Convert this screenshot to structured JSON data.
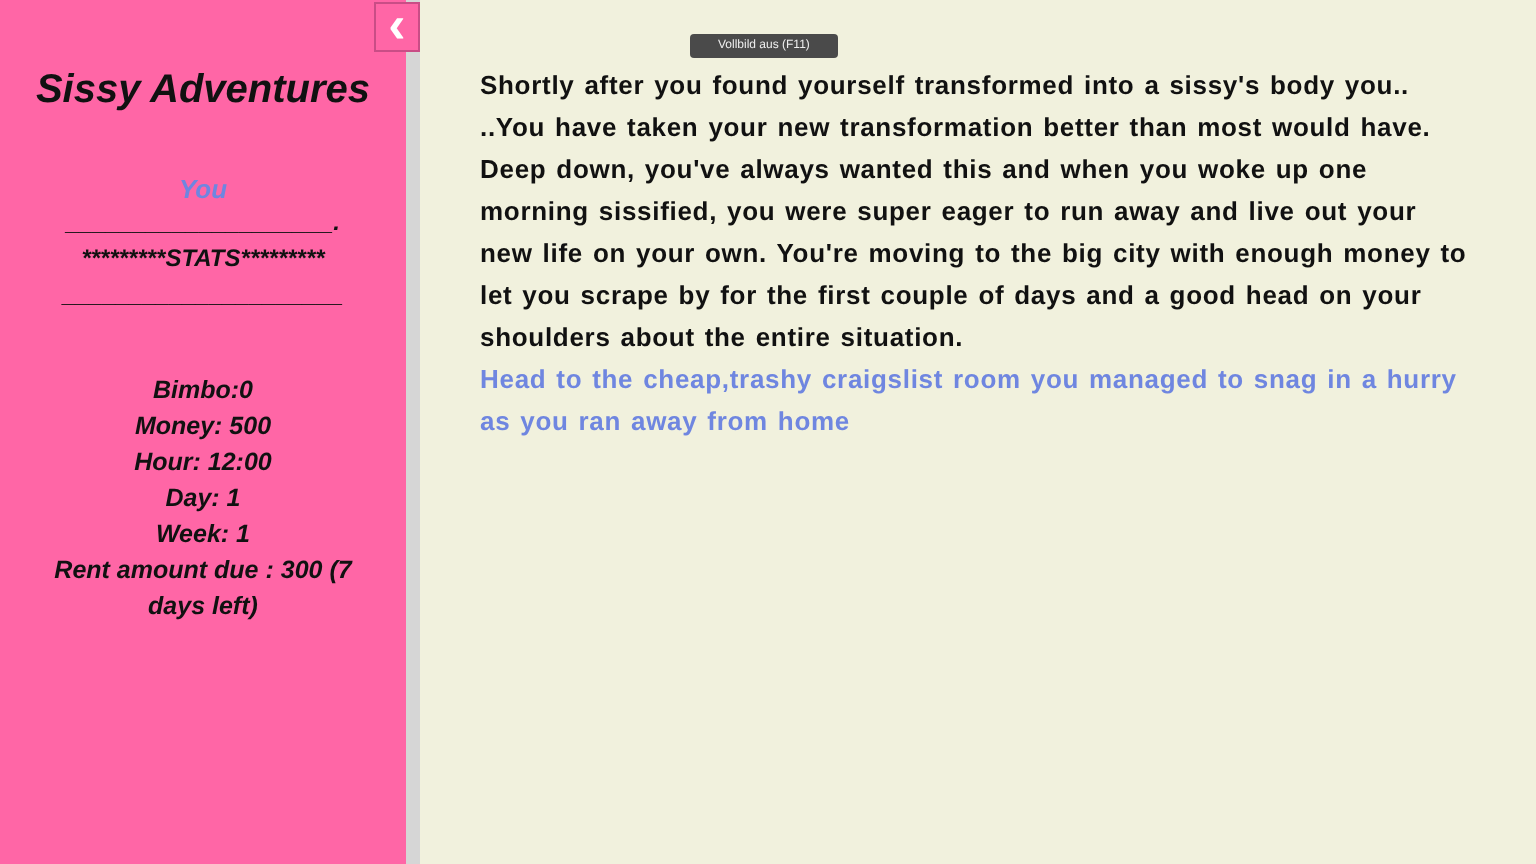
{
  "sidebar": {
    "toggle_button": "‹",
    "title": "Sissy Adventures",
    "link": "You",
    "divider_1": "____________________.",
    "stats_heading": "*********STATS*********",
    "divider_2": "_____________________",
    "stats": [
      "Bimbo:0",
      "Money: 500",
      "Hour: 12:00",
      "Day: 1",
      "Week: 1",
      "Rent amount due : 300 (7 days left)"
    ]
  },
  "tooltip": "Vollbild aus (F11)",
  "passage": {
    "text": "Shortly after you found yourself transformed into a sissy's body you.. ..You have taken your new transformation better than most would have. Deep down, you've always wanted this and when you woke up one morning sissified, you were super eager to run away and live out your new life on your own. You're moving to the big city with enough money to let you scrape by for the first couple of days and a good head on your shoulders about the entire situation.",
    "link": "Head to the cheap,trashy craigslist room you managed to snag in a hurry as you ran away from home"
  }
}
